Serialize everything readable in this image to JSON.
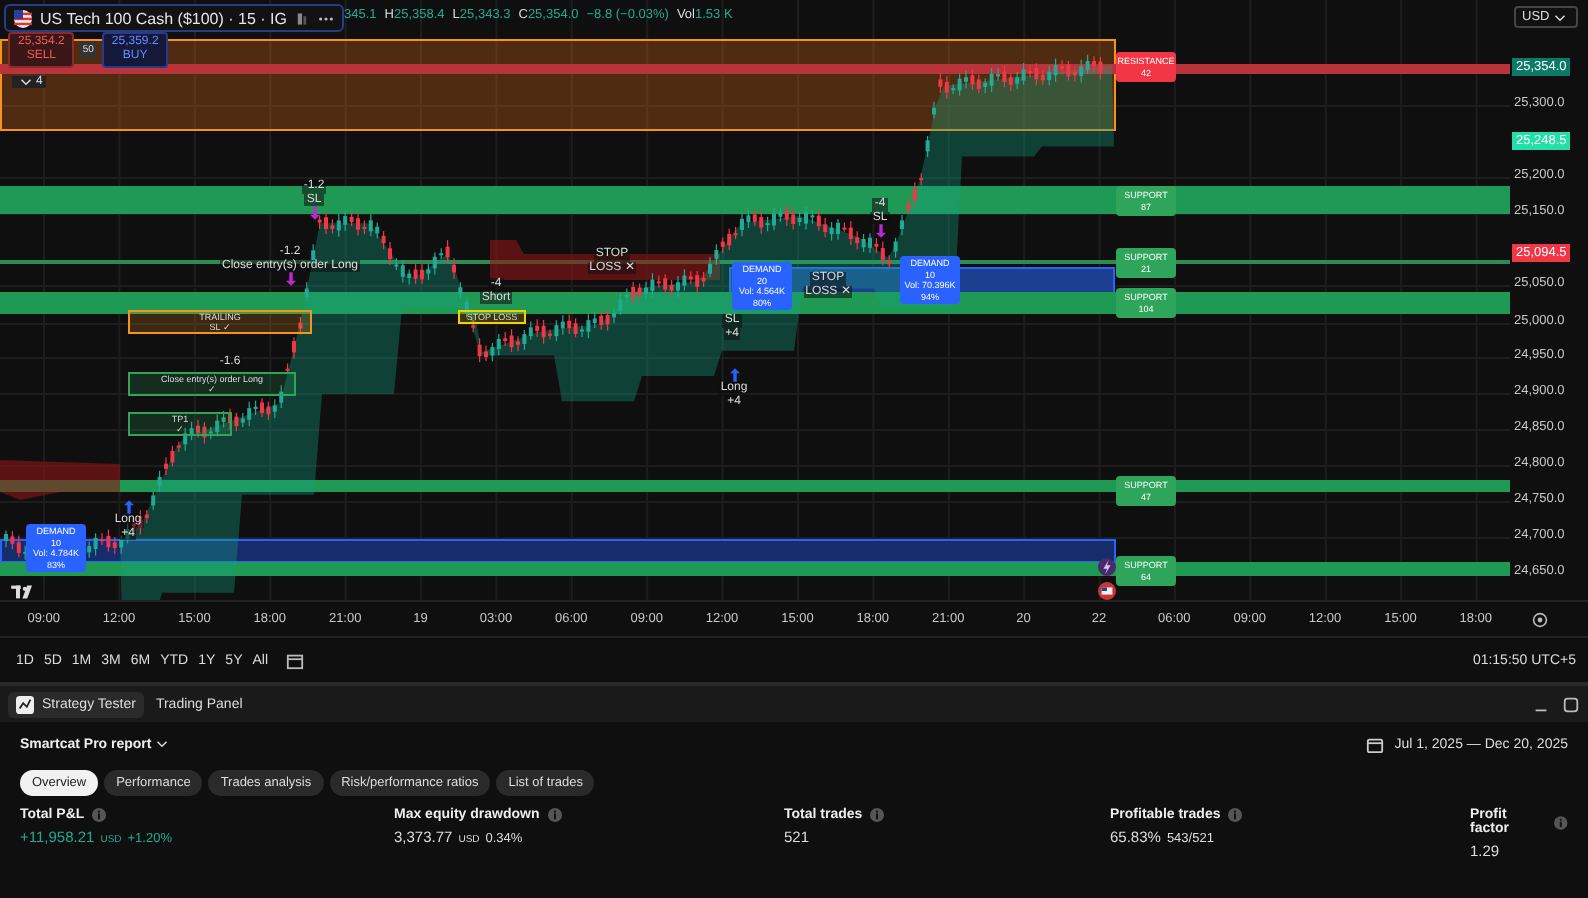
{
  "symbol": {
    "name": "US Tech 100 Cash ($100) · 15 · IG",
    "ohlc": [
      {
        "value": "345.1"
      },
      {
        "prefix": "H",
        "value": "25,358.4"
      },
      {
        "prefix": "L",
        "value": "25,343.3"
      },
      {
        "prefix": "C",
        "value": "25,354.0"
      },
      {
        "value": "−8.8 (−0.03%)"
      },
      {
        "prefix": "Vol",
        "value": "1.53 K"
      }
    ]
  },
  "order": {
    "sell_price": "25,354.2",
    "sell_label": "SELL",
    "spread": "50",
    "buy_price": "25,359.2",
    "buy_label": "BUY"
  },
  "indicators_count": "4",
  "currency": "USD",
  "price_axis": [
    "25,300.0",
    "25,200.0",
    "25,150.0",
    "25,050.0",
    "25,000.0",
    "24,950.0",
    "24,900.0",
    "24,850.0",
    "24,800.0",
    "24,750.0",
    "24,700.0",
    "24,650.0"
  ],
  "price_badges": [
    {
      "value": "25,354.0",
      "color": "#0b7a68"
    },
    {
      "value": "25,248.5",
      "color": "#22e0a8"
    },
    {
      "value": "25,094.5",
      "color": "#f23645"
    }
  ],
  "zone_labels": [
    {
      "title": "RESISTANCE",
      "count": "42",
      "color": "#f23645"
    },
    {
      "title": "SUPPORT",
      "count": "87",
      "color": "#2ea55a"
    },
    {
      "title": "SUPPORT",
      "count": "21",
      "color": "#2ea55a"
    },
    {
      "title": "SUPPORT",
      "count": "104",
      "color": "#2ea55a"
    },
    {
      "title": "SUPPORT",
      "count": "47",
      "color": "#2ea55a"
    },
    {
      "title": "SUPPORT",
      "count": "64",
      "color": "#2ea55a"
    }
  ],
  "demand_labels": [
    {
      "title": "DEMAND",
      "count": "10",
      "volume": "Vol: 4.784K",
      "share": "83%"
    },
    {
      "title": "DEMAND",
      "count": "20",
      "volume": "Vol: 4.564K",
      "share": "80%"
    },
    {
      "title": "DEMAND",
      "count": "10",
      "volume": "Vol: 70.396K",
      "share": "94%"
    }
  ],
  "trade_labels": [
    {
      "kind": "exit",
      "lines": [
        "-1.2",
        "SL"
      ]
    },
    {
      "kind": "exit",
      "lines": [
        "-1.2",
        "Close entry(s) order Long"
      ]
    },
    {
      "kind": "tag",
      "color": "#f7931a",
      "lines": [
        "TRAILING",
        "SL ✓"
      ]
    },
    {
      "kind": "plain",
      "lines": [
        "-1.6"
      ]
    },
    {
      "kind": "tag",
      "color": "#2ea55a",
      "lines": [
        "Close entry(s) order Long",
        "✓"
      ]
    },
    {
      "kind": "tag",
      "color": "#2ea55a",
      "lines": [
        "TP1",
        "✓"
      ]
    },
    {
      "kind": "entry",
      "lines": [
        "Long",
        "+4"
      ]
    },
    {
      "kind": "plain",
      "lines": [
        "-4",
        "Short"
      ]
    },
    {
      "kind": "plain",
      "lines": [
        "STOP",
        "LOSS ✕"
      ]
    },
    {
      "kind": "tag",
      "color": "#f5d000",
      "lines": [
        "STOP LOSS"
      ]
    },
    {
      "kind": "plain",
      "lines": [
        "SL",
        "+4"
      ]
    },
    {
      "kind": "entry",
      "lines": [
        "Long",
        "+4"
      ]
    },
    {
      "kind": "exit",
      "lines": [
        "-4",
        "SL"
      ]
    },
    {
      "kind": "plain",
      "lines": [
        "STOP",
        "LOSS ✕"
      ]
    }
  ],
  "time_axis": [
    "09:00",
    "12:00",
    "15:00",
    "18:00",
    "21:00",
    "19",
    "03:00",
    "06:00",
    "09:00",
    "12:00",
    "15:00",
    "18:00",
    "21:00",
    "20",
    "22",
    "06:00",
    "09:00",
    "12:00",
    "15:00",
    "18:00"
  ],
  "ranges": [
    "1D",
    "5D",
    "1M",
    "3M",
    "6M",
    "YTD",
    "1Y",
    "5Y",
    "All"
  ],
  "clock": "01:15:50 UTC+5",
  "panel_tabs": [
    {
      "label": "Strategy Tester",
      "selected": true
    },
    {
      "label": "Trading Panel",
      "selected": false
    }
  ],
  "report": {
    "title": "Smartcat Pro report",
    "date_range": "Jul 1, 2025 — Dec 20, 2025",
    "pills": [
      {
        "label": "Overview",
        "selected": true
      },
      {
        "label": "Performance",
        "selected": false
      },
      {
        "label": "Trades analysis",
        "selected": false
      },
      {
        "label": "Risk/performance ratios",
        "selected": false
      },
      {
        "label": "List of trades",
        "selected": false
      }
    ],
    "metrics": [
      {
        "label": "Total P&L",
        "value": "+11,958.21",
        "unit": "USD",
        "extra": "+1.20%",
        "positive": true
      },
      {
        "label": "Max equity drawdown",
        "value": "3,373.77",
        "unit": "USD",
        "extra": "0.34%",
        "positive": false
      },
      {
        "label": "Total trades",
        "value": "521",
        "positive": false
      },
      {
        "label": "Profitable trades",
        "value": "65.83%",
        "extra": "543/521",
        "positive": false
      },
      {
        "label": "Profit factor",
        "value": "1.29",
        "positive": false
      }
    ]
  }
}
